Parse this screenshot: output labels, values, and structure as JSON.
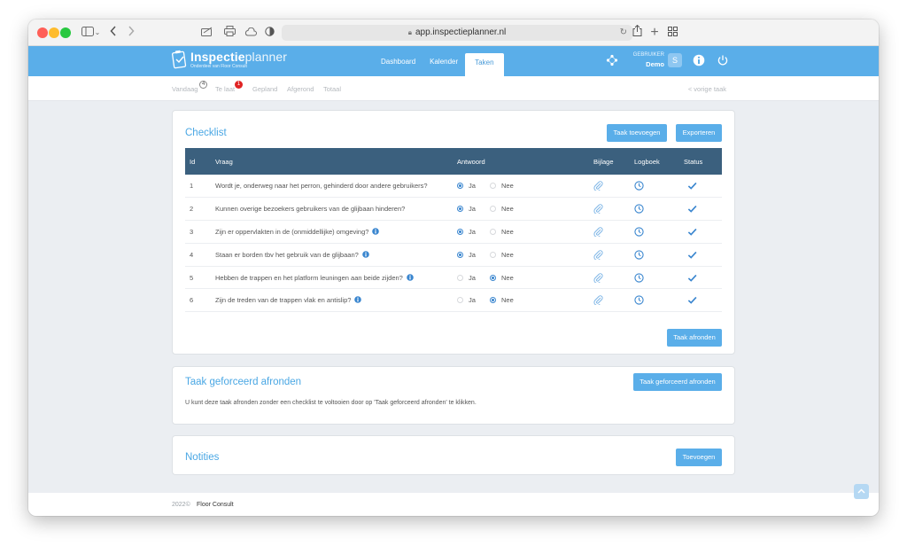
{
  "browser": {
    "url": "app.inspectieplanner.nl"
  },
  "header": {
    "logo_bold": "Inspectie",
    "logo_light": "planner",
    "logo_sub": "Onderdeel van Floor Consult",
    "nav": [
      {
        "label": "Dashboard"
      },
      {
        "label": "Kalender"
      },
      {
        "label": "Taken"
      }
    ],
    "user_label": "GEBRUIKER",
    "user_name": "Demo",
    "avatar_letter": "S"
  },
  "subnav": {
    "items": [
      {
        "label": "Vandaag",
        "badge": "4"
      },
      {
        "label": "Te laat",
        "badge": "1"
      },
      {
        "label": "Gepland"
      },
      {
        "label": "Afgerond"
      },
      {
        "label": "Totaal"
      }
    ],
    "prev_link": "< vorige taak"
  },
  "checklist": {
    "title": "Checklist",
    "add_button": "Taak toevoegen",
    "export_button": "Exporteren",
    "columns": [
      "Id",
      "Vraag",
      "Antwoord",
      "Bijlage",
      "Logboek",
      "Status"
    ],
    "yes_label": "Ja",
    "no_label": "Nee",
    "rows": [
      {
        "id": "1",
        "question": "Wordt je, onderweg naar het perron, gehinderd door andere gebruikers?",
        "answer": "ja",
        "info": false
      },
      {
        "id": "2",
        "question": "Kunnen overige bezoekers gebruikers van de glijbaan hinderen?",
        "answer": "ja",
        "info": false
      },
      {
        "id": "3",
        "question": "Zijn er oppervlakten in de (onmiddellijke) omgeving?",
        "answer": "ja",
        "info": true
      },
      {
        "id": "4",
        "question": "Staan er borden tbv het gebruik van de glijbaan?",
        "answer": "ja",
        "info": true
      },
      {
        "id": "5",
        "question": "Hebben de trappen en het platform leuningen aan beide zijden?",
        "answer": "nee",
        "info": true
      },
      {
        "id": "6",
        "question": "Zijn de treden van de trappen vlak en antislip?",
        "answer": "nee",
        "info": true
      }
    ],
    "finish_button": "Taak afronden"
  },
  "forced": {
    "title": "Taak geforceerd afronden",
    "button": "Taak geforceerd afronden",
    "description": "U kunt deze taak afronden zonder een checklist te voltooien door op 'Taak geforceerd afronden' te klikken."
  },
  "notes": {
    "title": "Notities",
    "button": "Toevoegen"
  },
  "footer": {
    "year": "2022©",
    "company": "Floor Consult"
  },
  "colors": {
    "brand": "#5aaee9",
    "table_header": "#3b607e",
    "accent_text": "#4aa7e4",
    "badge_red": "#e02424"
  },
  "icons": {
    "attachment": "paperclip-icon",
    "logbook": "clock-icon",
    "status": "checkmark-icon",
    "info": "info-icon"
  }
}
